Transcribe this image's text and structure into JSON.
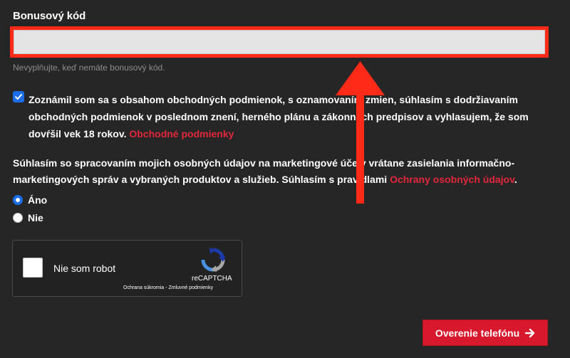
{
  "bonus": {
    "label": "Bonusový kód",
    "value": "",
    "placeholder": "",
    "hint": "Nevyplňujte, keď nemáte bonusový kód."
  },
  "terms": {
    "checked": true,
    "text": "Zoznámil som sa s obsahom obchodných podmienok, s oznamovaním zmien, súhlasím s dodržiavaním obchodných podmienok v poslednom znení, herného plánu a zákonných predpisov a vyhlasujem, že som dovŕšil vek 18 rokov.",
    "link": "Obchodné podmienky"
  },
  "marketing": {
    "text": "Súhlasím so spracovaním mojich osobných údajov na marketingové účely vrátane zasielania informačno-marketingových správ a vybraných produktov a služieb. Súhlasím s pravidlami",
    "link": "Ochrany osobných údajov",
    "suffix": ".",
    "options": [
      {
        "label": "Áno",
        "selected": true
      },
      {
        "label": "Nie",
        "selected": false
      }
    ]
  },
  "captcha": {
    "label": "Nie som robot",
    "brand": "reCAPTCHA",
    "privacy": "Ochrana súkromia",
    "separator": " - ",
    "terms": "Zmluvné podmienky"
  },
  "submit": {
    "label": "Overenie telefónu",
    "icon": "arrow-right-icon"
  },
  "colors": {
    "background": "#262626",
    "highlight": "#ff2a17",
    "link": "#e2263b",
    "button": "#d8182d",
    "checkbox": "#1c6ee8"
  }
}
